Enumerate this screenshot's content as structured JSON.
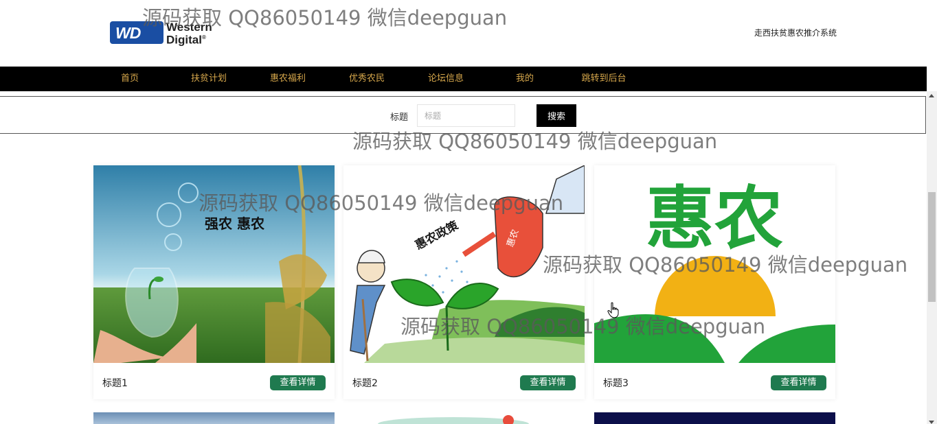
{
  "header": {
    "logo": {
      "badge": "WD",
      "line1": "Western",
      "line2": "Digital",
      "reg": "®"
    },
    "site_name": "走西扶贫惠农推介系统"
  },
  "nav": {
    "items": [
      "首页",
      "扶贫计划",
      "惠农福利",
      "优秀农民",
      "论坛信息",
      "我的",
      "跳转到后台"
    ]
  },
  "search": {
    "label": "标题",
    "placeholder": "标题",
    "button": "搜索"
  },
  "cards": [
    {
      "title": "标题1",
      "button": "查看详情",
      "image_text": "强农 惠农"
    },
    {
      "title": "标题2",
      "button": "查看详情",
      "image_text": "惠农政策",
      "can_text": "惠农"
    },
    {
      "title": "标题3",
      "button": "查看详情",
      "image_text": "惠农"
    }
  ],
  "watermark": "源码获取 QQ86050149 微信deepguan",
  "colors": {
    "nav_bg": "#000000",
    "nav_text": "#d7a84c",
    "button_green": "#1f7a4f",
    "search_button": "#000000",
    "logo_blue": "#1a4ea3"
  }
}
